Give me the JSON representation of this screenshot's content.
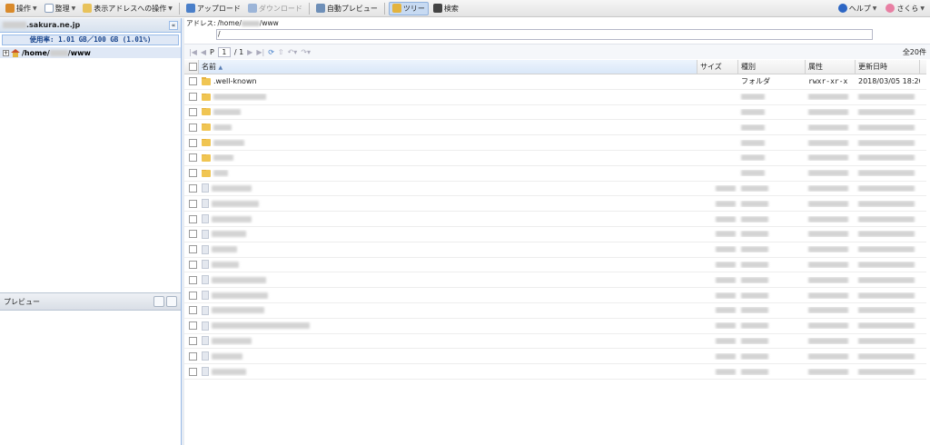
{
  "toolbar": {
    "operate": "操作",
    "organize": "整理",
    "address_ops": "表示アドレスへの操作",
    "upload": "アップロード",
    "download": "ダウンロード",
    "auto_preview": "自動プレビュー",
    "tree": "ツリー",
    "search": "検索",
    "help": "ヘルプ",
    "user": "さくら"
  },
  "left_panel": {
    "server_domain": ".sakura.ne.jp",
    "collapse_glyph": "«",
    "usage": "使用率: 1.01 GB／100 GB (1.01%)",
    "tree_prefix": "/home/",
    "tree_suffix": "/www",
    "preview_title": "プレビュー"
  },
  "address": {
    "label": "アドレス:",
    "path_prefix": "/home/",
    "path_suffix": "/www",
    "current": "/"
  },
  "pager": {
    "page_label": "P",
    "page_current": "1",
    "page_total": "/ 1",
    "total": "全20件"
  },
  "grid": {
    "headers": {
      "name": "名前",
      "size": "サイズ",
      "type": "種別",
      "attr": "属性",
      "date": "更新日時"
    },
    "visible_row": {
      "name": ".well-known",
      "type": "フォルダ",
      "attr": "rwxr-xr-x",
      "date": "2018/03/05 18:20"
    },
    "row_count": 20
  },
  "colors": {
    "accent": "#99bbe8",
    "selection": "#dfe8f6",
    "pressed": "#c7daf2"
  }
}
